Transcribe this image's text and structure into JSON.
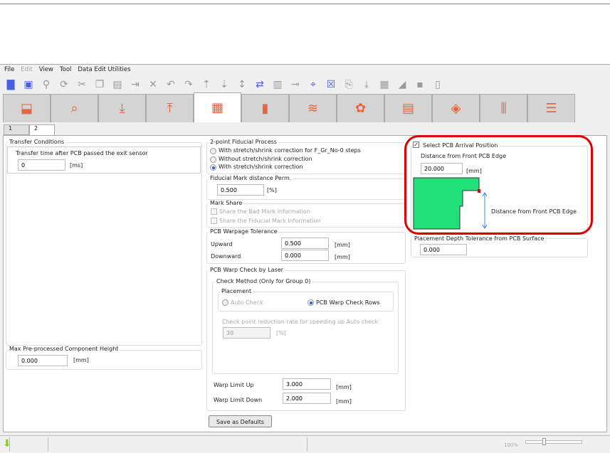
{
  "menu": {
    "file": "File",
    "edit": "Edit",
    "view": "View",
    "tool": "Tool",
    "data_edit": "Data Edit Utilities"
  },
  "toolbar": [
    "new-icon",
    "save-icon",
    "search-icon",
    "refresh-icon",
    "cut-icon",
    "copy-icon",
    "paste-icon",
    "insert-after-icon",
    "delete-icon",
    "undo-icon",
    "redo-icon",
    "move-up-icon",
    "move-down-icon",
    "spacing-icon",
    "swap-icon",
    "component-icon",
    "nozzle-icon",
    "fiducial-icon",
    "close-x-icon",
    "import-icon",
    "pickup-icon",
    "feeder-icon",
    "ramp-icon",
    "group-icon",
    "split-icon"
  ],
  "tabs": [
    "placement-head-tab",
    "pcb-inspect-tab",
    "pickup-tab",
    "place-tab",
    "pcb-size-tab",
    "component-tab",
    "feeder-tab",
    "reel-tab",
    "document-tab",
    "layer-tab",
    "nozzle-tab",
    "list-tab"
  ],
  "subtabs": [
    "1",
    "2"
  ],
  "transfer": {
    "title": "Transfer Conditions",
    "label": "Transfer time after PCB passed the exit sensor",
    "value": "0",
    "unit": "[ms]"
  },
  "max_height": {
    "title": "Max Pre-processed Component Height",
    "value": "0.000",
    "unit": "[mm]"
  },
  "fiducial": {
    "title": "2-point Fiducial Process",
    "opt1": "With stretch/shrink correction for F_Gr_No-0 steps",
    "opt2": "Without stretch/shrink correction",
    "opt3": "With stretch/shrink correction"
  },
  "fid_dist": {
    "title": "Fiducial Mark distance Perm.",
    "value": "0.500",
    "unit": "[%]"
  },
  "mark_share": {
    "title": "Mark Share",
    "bad": "Share the Bad Mark Information",
    "fid": "Share the Fiducial Mark Information"
  },
  "warpage": {
    "title": "PCB Warpage Tolerance",
    "up_label": "Upward",
    "up_value": "0.500",
    "down_label": "Downward",
    "down_value": "0.000",
    "unit": "[mm]"
  },
  "laser": {
    "title": "PCB Warp Check by Laser",
    "method": "Check Method (Only for Group 0)",
    "placement": "Placement",
    "auto": "Auto Check",
    "rows": "PCB Warp Check Rows",
    "reduction_label": "Check point reduction rate for speeding up Auto check",
    "reduction_value": "30",
    "reduction_unit": "[%]",
    "up_label": "Warp Limit Up",
    "up_value": "3.000",
    "down_label": "Warp Limit Down",
    "down_value": "2.000",
    "unit": "[mm]"
  },
  "save_defaults": "Save as Defaults",
  "arrival": {
    "title": "Select PCB Arrival Position",
    "label": "Distance from Front PCB Edge",
    "value": "20.000",
    "unit": "[mm]",
    "diagram_label": "Distance from Front PCB Edge"
  },
  "depth": {
    "title": "Placement Depth Tolerance from PCB Surface",
    "value": "0.000"
  },
  "status": {
    "zoom": "100%"
  },
  "colors": {
    "accent": "#e8643c",
    "highlight": "#e00000",
    "pcb": "#22e07a"
  }
}
